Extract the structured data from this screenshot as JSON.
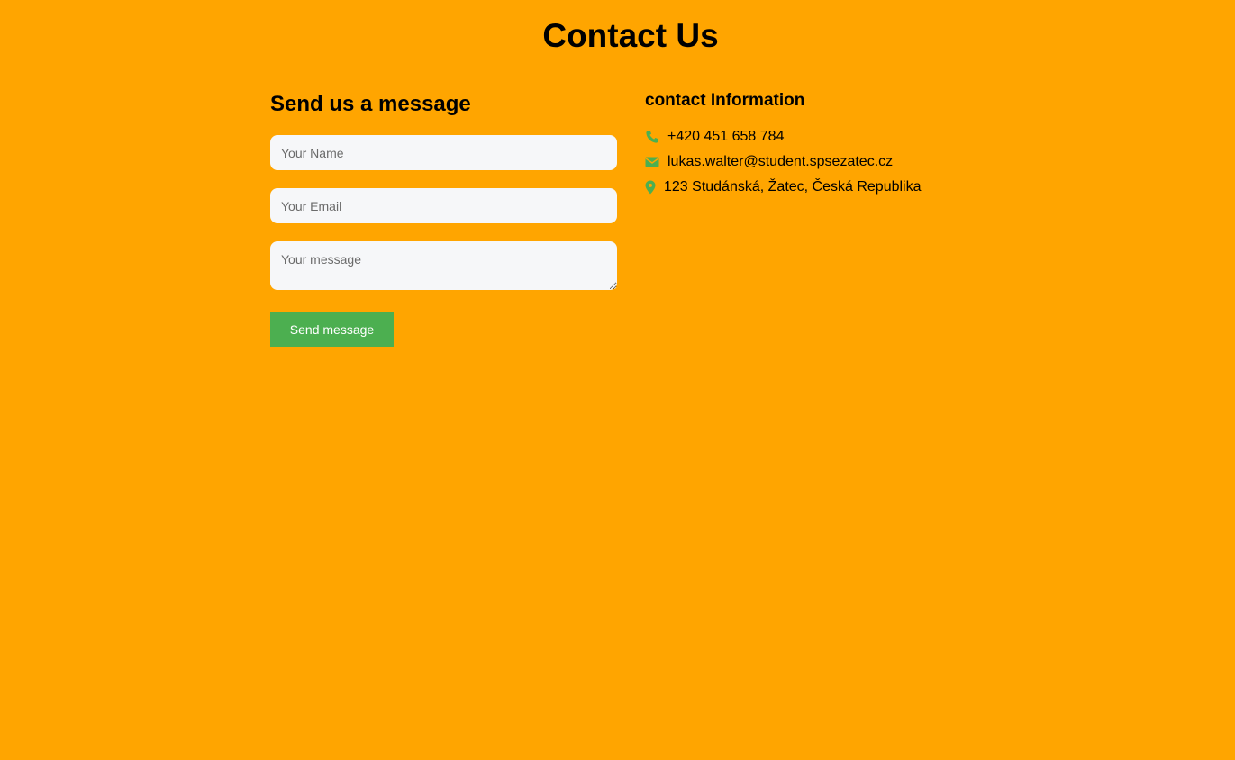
{
  "page": {
    "title": "Contact Us"
  },
  "form": {
    "heading": "Send us a message",
    "name_placeholder": "Your Name",
    "email_placeholder": "Your Email",
    "message_placeholder": "Your message",
    "submit_label": "Send message"
  },
  "contact": {
    "heading": "contact Information",
    "phone": "+420 451 658 784",
    "email": "lukas.walter@student.spsezatec.cz",
    "address": "123 Studánská, Žatec, Česká Republika"
  },
  "icons": {
    "phone": "phone-icon",
    "email": "envelope-icon",
    "address": "map-marker-icon"
  },
  "colors": {
    "background": "#FFA500",
    "accent": "#4CAF50",
    "input_bg": "#F6F7F9"
  }
}
